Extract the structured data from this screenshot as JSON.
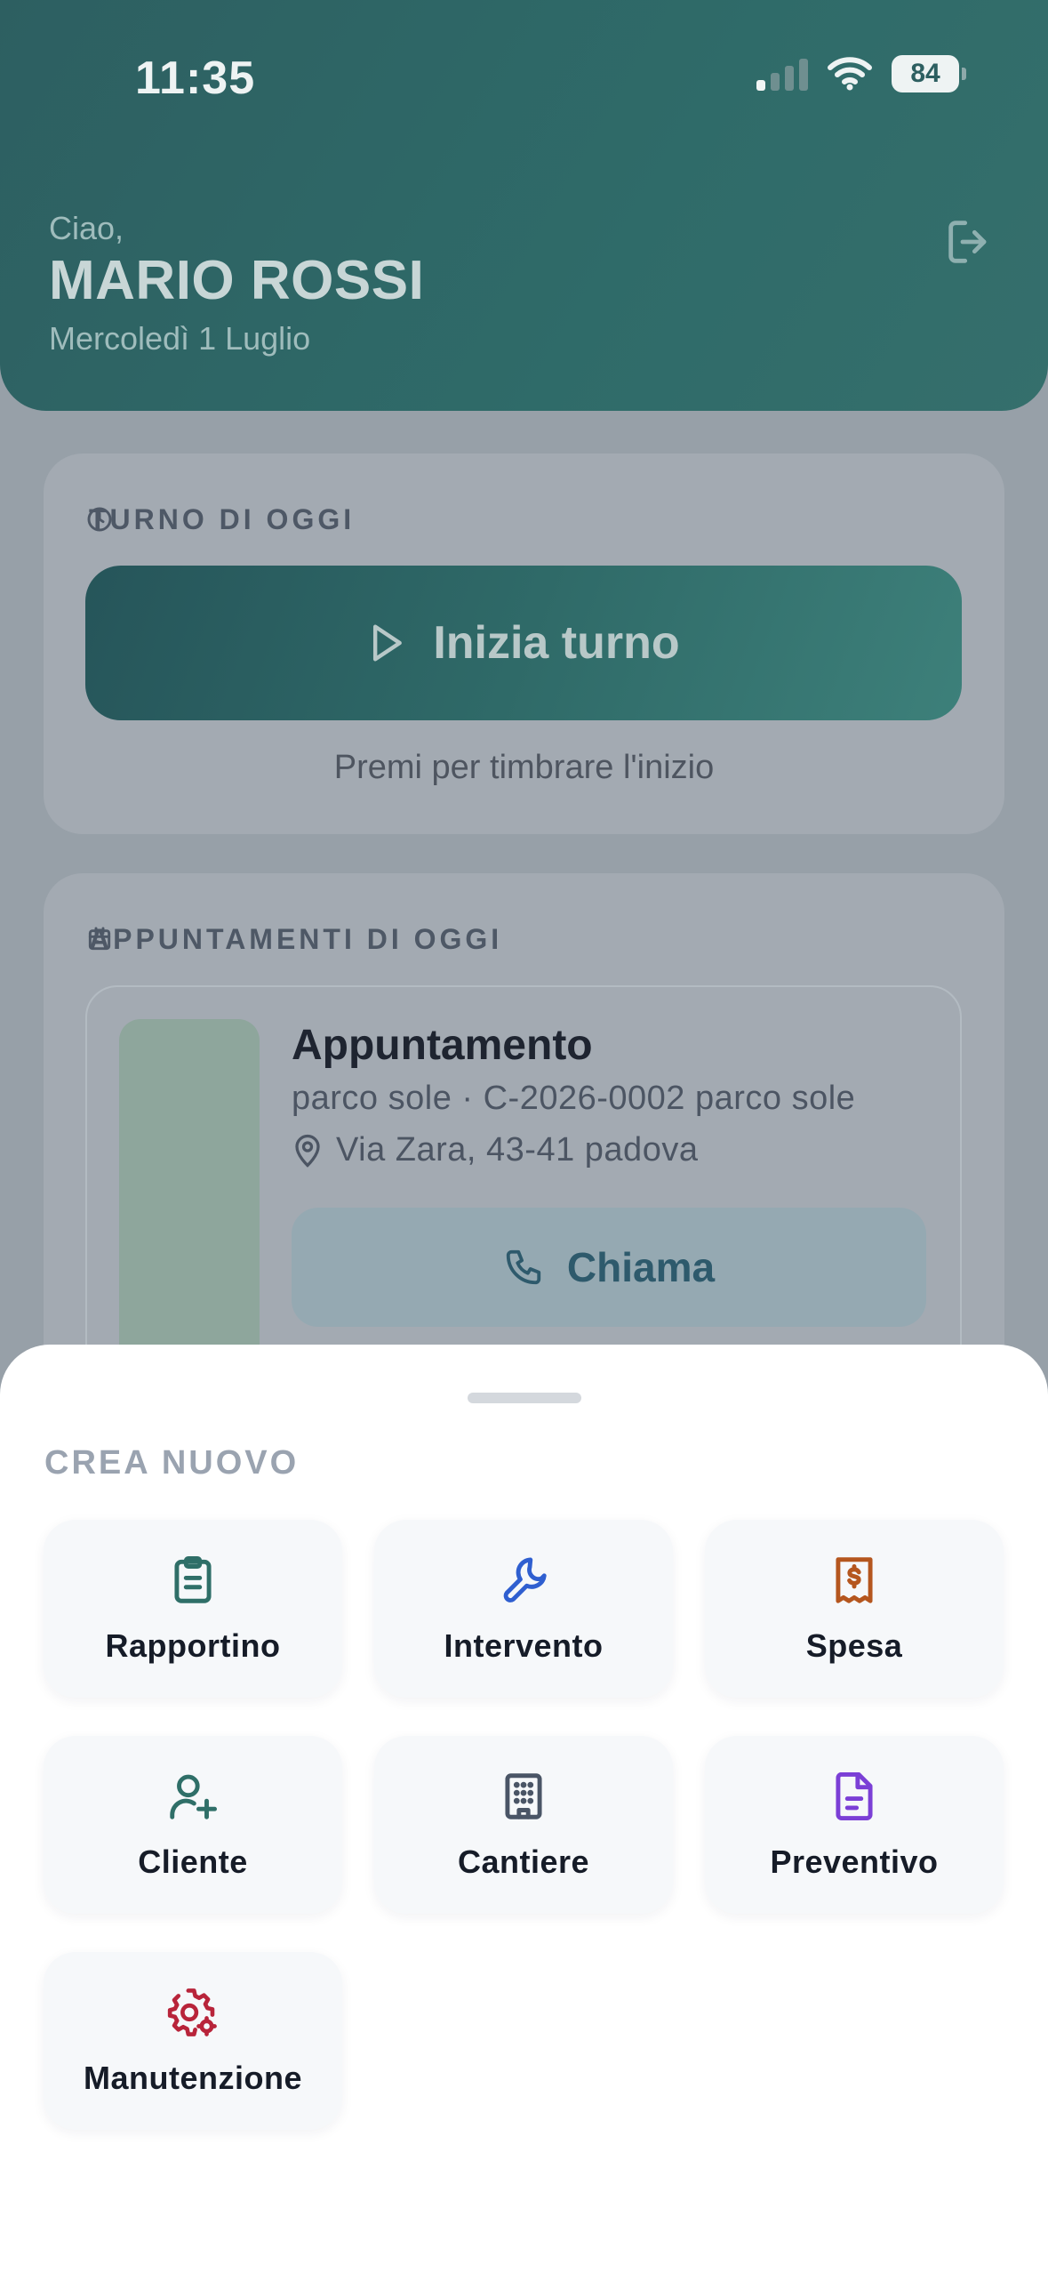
{
  "status_bar": {
    "time": "11:35",
    "battery": "84"
  },
  "header": {
    "greeting": "Ciao,",
    "user_name": "MARIO ROSSI",
    "date": "Mercoledì 1 Luglio",
    "logout_icon": "logout-icon"
  },
  "shift": {
    "title": "TURNO DI OGGI",
    "start_label": "Inizia turno",
    "hint": "Premi per timbrare l'inizio"
  },
  "appointments": {
    "title": "APPUNTAMENTI DI OGGI",
    "items": [
      {
        "title": "Appuntamento",
        "subtitle": "parco sole · C-2026-0002 parco sole",
        "address": "Via Zara, 43-41 padova",
        "call_label": "Chiama"
      }
    ]
  },
  "sheet": {
    "title": "CREA NUOVO",
    "tiles": [
      {
        "label": "Rapportino",
        "icon": "clipboard-icon",
        "color": "#2f6f68"
      },
      {
        "label": "Intervento",
        "icon": "wrench-icon",
        "color": "#2f5fd0"
      },
      {
        "label": "Spesa",
        "icon": "receipt-icon",
        "color": "#b5561e"
      },
      {
        "label": "Cliente",
        "icon": "user-plus-icon",
        "color": "#2f6f68"
      },
      {
        "label": "Cantiere",
        "icon": "building-icon",
        "color": "#4a5566"
      },
      {
        "label": "Preventivo",
        "icon": "document-icon",
        "color": "#7b3fd6"
      },
      {
        "label": "Manutenzione",
        "icon": "gear-icon",
        "color": "#b8243a"
      }
    ]
  }
}
